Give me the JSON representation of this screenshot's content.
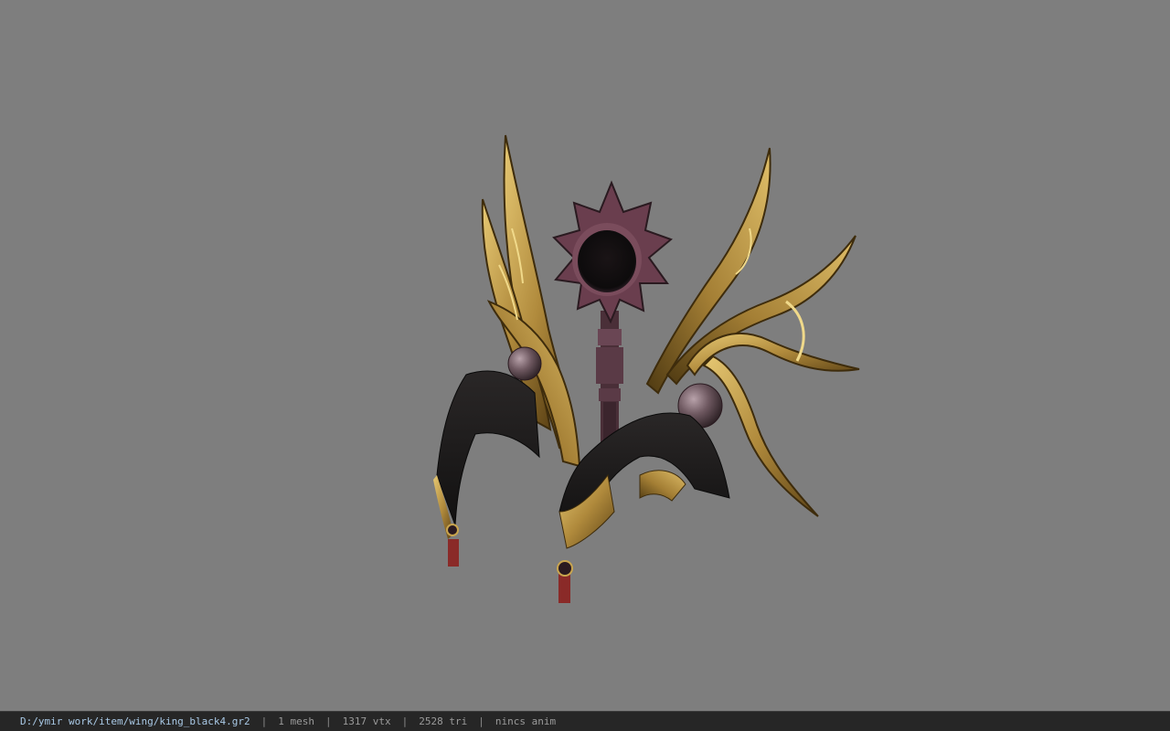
{
  "viewer": {
    "background": "#7e7e7e",
    "model_name": "king_black4"
  },
  "statusbar": {
    "path": "D:/ymir work/item/wing/king_black4.gr2",
    "separator": "|",
    "mesh": "1 mesh",
    "vertices": "1317 vtx",
    "triangles": "2528 tri",
    "anim": "nincs anim"
  },
  "colors": {
    "gold": "#b08a3c",
    "gold_dark": "#6b4f1c",
    "gold_light": "#e6c873",
    "ribbon": "#1c1a1a",
    "orb": "#6e5860",
    "sun_purple": "#6a3e4e",
    "tassel_red": "#8a2a28"
  }
}
